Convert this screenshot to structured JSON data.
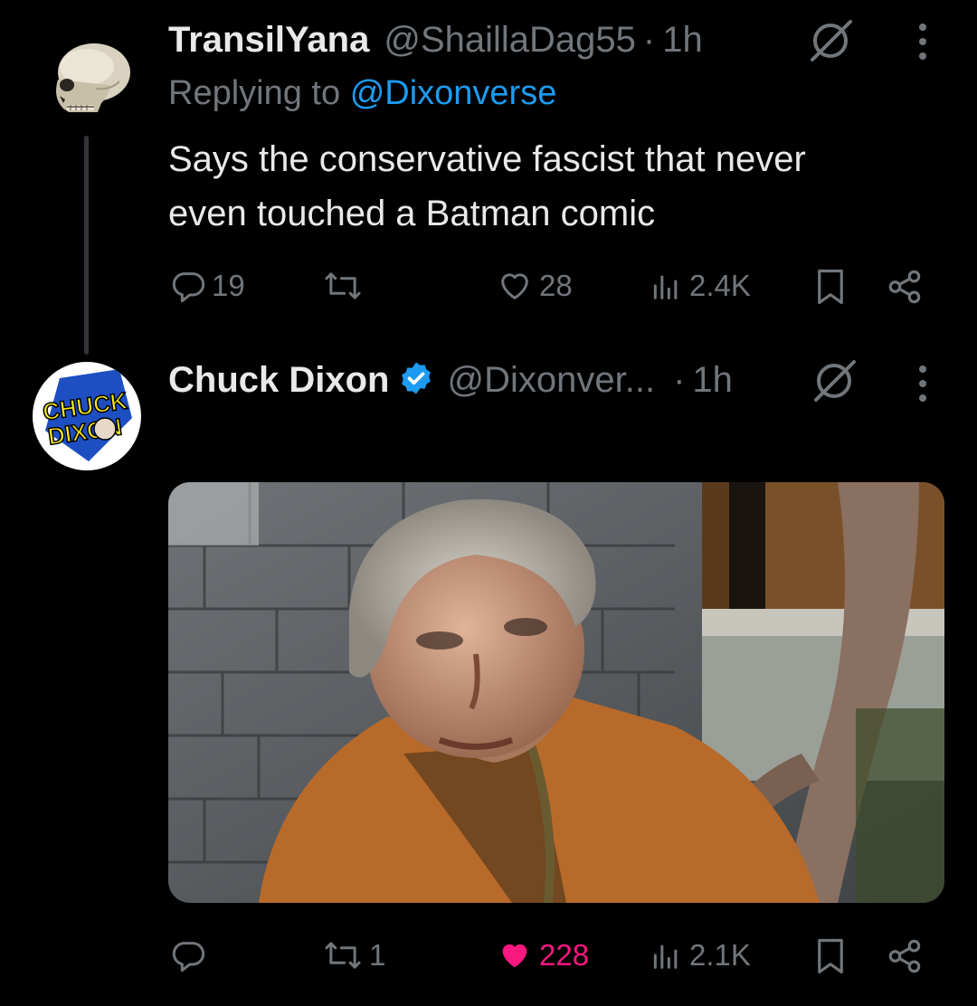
{
  "reply_tweet": {
    "display_name": "TransilYana",
    "handle": "@ShaillaDag55",
    "separator": "·",
    "time": "1h",
    "replying_prefix": "Replying to",
    "replying_to": "@Dixonverse",
    "text_line1": "Says the conservative fascist that never",
    "text_line2": "even touched a Batman comic",
    "actions": {
      "replies": "19",
      "reposts": "",
      "likes": "28",
      "views": "2.4K"
    },
    "icons": [
      "skull-avatar",
      "grok-icon",
      "more-icon",
      "reply-icon",
      "repost-icon",
      "like-icon",
      "views-icon",
      "bookmark-icon",
      "share-icon"
    ]
  },
  "main_tweet": {
    "display_name": "Chuck Dixon",
    "handle": "@Dixonver...",
    "separator": "·",
    "time": "1h",
    "verified": true,
    "avatar_text_line1": "CHUCK",
    "avatar_text_line2": "DIXON",
    "actions": {
      "replies": "",
      "reposts": "1",
      "likes": "228",
      "views": "2.1K"
    },
    "liked": true
  },
  "colors": {
    "background": "#000000",
    "text": "#e7e9ea",
    "muted": "#71767b",
    "link": "#1d9bf0",
    "like": "#f91880",
    "verified": "#1d9bf0"
  }
}
